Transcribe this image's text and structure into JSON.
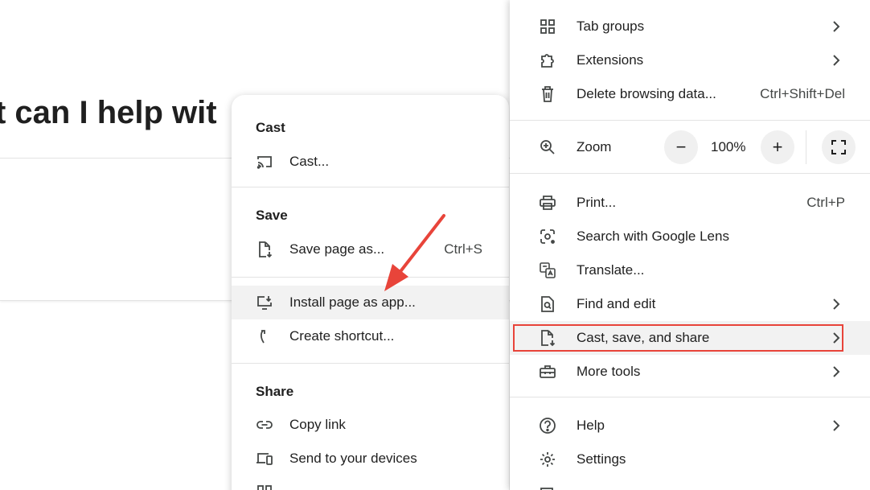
{
  "background": {
    "heading": "t can I help wit"
  },
  "submenu": {
    "sections": [
      {
        "heading": "Cast",
        "items": [
          {
            "label": "Cast...",
            "icon": "cast-icon"
          }
        ]
      },
      {
        "heading": "Save",
        "items": [
          {
            "label": "Save page as...",
            "shortcut": "Ctrl+S",
            "icon": "save-page-icon"
          },
          {
            "label": "Install page as app...",
            "icon": "install-app-icon"
          },
          {
            "label": "Create shortcut...",
            "icon": "shortcut-icon"
          }
        ]
      },
      {
        "heading": "Share",
        "items": [
          {
            "label": "Copy link",
            "icon": "link-icon"
          },
          {
            "label": "Send to your devices",
            "icon": "devices-icon"
          }
        ]
      }
    ]
  },
  "main_menu": {
    "items": [
      {
        "label": "Tab groups",
        "icon": "tab-groups-icon",
        "has_submenu": true
      },
      {
        "label": "Extensions",
        "icon": "puzzle-icon",
        "has_submenu": true
      },
      {
        "label": "Delete browsing data...",
        "shortcut": "Ctrl+Shift+Del",
        "icon": "trash-icon"
      },
      {
        "label": "Print...",
        "shortcut": "Ctrl+P",
        "icon": "print-icon"
      },
      {
        "label": "Search with Google Lens",
        "icon": "lens-icon"
      },
      {
        "label": "Translate...",
        "icon": "translate-icon"
      },
      {
        "label": "Find and edit",
        "icon": "find-icon",
        "has_submenu": true
      },
      {
        "label": "Cast, save, and share",
        "icon": "cast-save-icon",
        "has_submenu": true
      },
      {
        "label": "More tools",
        "icon": "toolbox-icon",
        "has_submenu": true
      },
      {
        "label": "Help",
        "icon": "help-icon",
        "has_submenu": true
      },
      {
        "label": "Settings",
        "icon": "gear-icon"
      }
    ],
    "zoom": {
      "label": "Zoom",
      "value": "100%",
      "minus": "−",
      "plus": "+"
    }
  },
  "colors": {
    "highlight_box": "#e8443a",
    "arrow": "#e8443a",
    "hover_bg": "#f2f2f2"
  }
}
